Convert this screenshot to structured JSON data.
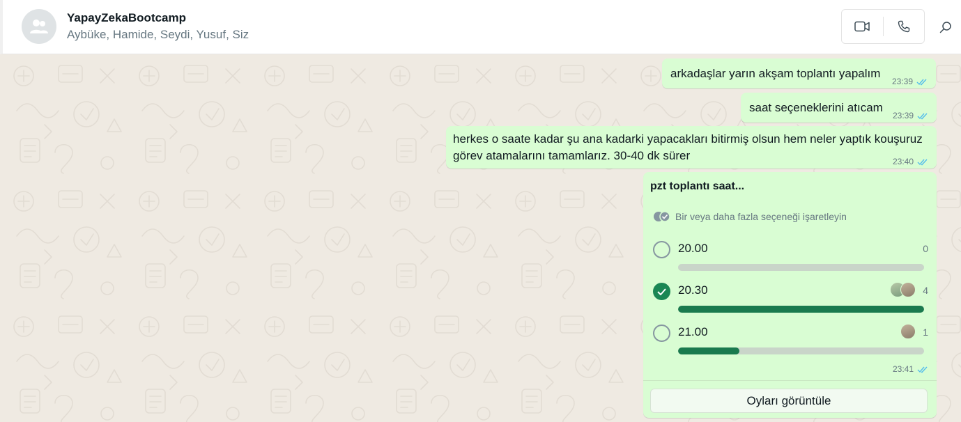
{
  "header": {
    "title": "YapayZekaBootcamp",
    "members": "Aybüke, Hamide, Seydi, Yusuf, Siz",
    "avatar_icon": "group-icon",
    "video_icon": "video-call-icon",
    "voice_icon": "voice-call-icon",
    "search_icon": "search-icon"
  },
  "messages": [
    {
      "text": "arkadaşlar yarın akşam toplantı yapalım",
      "time": "23:39",
      "status": "read"
    },
    {
      "text": "saat seçeneklerini atıcam",
      "time": "23:39",
      "status": "read"
    },
    {
      "text": "herkes o saate kadar şu ana kadarki yapacakları bitirmiş olsun hem neler yaptık kouşuruz görev atamalarını tamamlarız. 30-40 dk sürer",
      "time": "23:40",
      "status": "read"
    }
  ],
  "poll": {
    "title": "pzt toplantı saat...",
    "hint": "Bir veya daha fazla seçeneği işaretleyin",
    "options": [
      {
        "label": "20.00",
        "votes": "0",
        "fraction": 0,
        "checked": false,
        "voters": 0
      },
      {
        "label": "20.30",
        "votes": "4",
        "fraction": 1,
        "checked": true,
        "voters": 2
      },
      {
        "label": "21.00",
        "votes": "1",
        "fraction": 0.25,
        "checked": false,
        "voters": 1
      }
    ],
    "time": "23:41",
    "status": "read",
    "view_votes_label": "Oyları görüntüle"
  },
  "colors": {
    "bubble": "#d9fdd3",
    "accent": "#1a8754",
    "read_tick": "#53bdeb",
    "chat_bg": "#efeae2"
  }
}
